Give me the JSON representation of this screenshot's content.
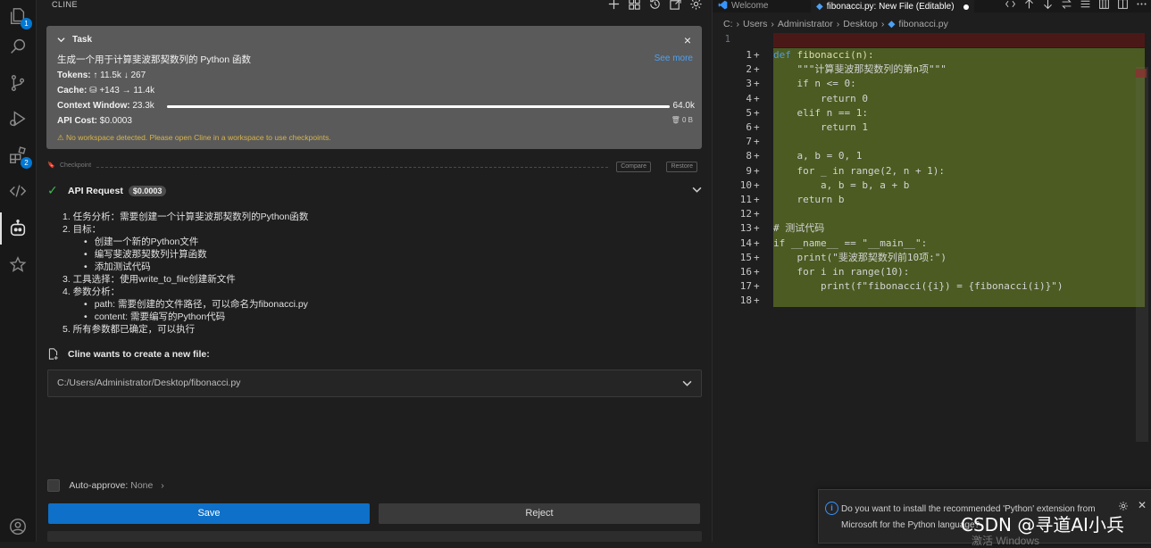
{
  "cline": {
    "header_title": "CLINE",
    "task": {
      "heading": "Task",
      "text": "生成一个用于计算斐波那契数列的 Python 函数",
      "see_more": "See more",
      "tokens_label": "Tokens:",
      "tokens_up": "11.5k",
      "tokens_down": "267",
      "cache_label": "Cache:",
      "cache_write": "+143",
      "cache_read": "11.4k",
      "context_label": "Context Window:",
      "context_used": "23.3k",
      "context_max": "64.0k",
      "cost_label": "API Cost:",
      "cost_value": "$0.0003",
      "storage_size": "0 B",
      "warning": "No workspace detected. Please open Cline in a workspace to use checkpoints."
    },
    "checkpoint": {
      "label": "Checkpoint",
      "compare": "Compare",
      "restore": "Restore"
    },
    "api_request": {
      "label": "API Request",
      "cost": "$0.0003"
    },
    "reasoning": [
      {
        "indent": 0,
        "text": "1. 任务分析：需要创建一个计算斐波那契数列的Python函数"
      },
      {
        "indent": 0,
        "text": "2. 目标："
      },
      {
        "indent": 1,
        "text": "创建一个新的Python文件"
      },
      {
        "indent": 1,
        "text": "编写斐波那契数列计算函数"
      },
      {
        "indent": 1,
        "text": "添加测试代码"
      },
      {
        "indent": 0,
        "text": "3. 工具选择：使用write_to_file创建新文件"
      },
      {
        "indent": 0,
        "text": "4. 参数分析："
      },
      {
        "indent": 1,
        "text": "path: 需要创建的文件路径，可以命名为fibonacci.py"
      },
      {
        "indent": 1,
        "text": "content: 需要编写的Python代码"
      },
      {
        "indent": 0,
        "text": "5. 所有参数都已确定，可以执行"
      }
    ],
    "new_file_title": "Cline wants to create a new file:",
    "file_path": "C:/Users/Administrator/Desktop/fibonacci.py",
    "auto_approve_label": "Auto-approve:",
    "auto_approve_value": "None",
    "save_label": "Save",
    "reject_label": "Reject"
  },
  "activity_bar": {
    "explorer_badge": "1",
    "extensions_badge": "2"
  },
  "editor": {
    "tabs": {
      "welcome": "Welcome",
      "active": "fibonacci.py: New File (Editable)"
    },
    "breadcrumbs": [
      "C:",
      "Users",
      "Administrator",
      "Desktop",
      "fibonacci.py"
    ],
    "original_line_number": "1",
    "code": {
      "1": "def fibonacci(n):",
      "2": "    \"\"\"计算斐波那契数列的第n项\"\"\"",
      "3": "    if n <= 0:",
      "4": "        return 0",
      "5": "    elif n == 1:",
      "6": "        return 1",
      "7": "",
      "8": "    a, b = 0, 1",
      "9": "    for _ in range(2, n + 1):",
      "10": "        a, b = b, a + b",
      "11": "    return b",
      "12": "",
      "13": "# 测试代码",
      "14": "if __name__ == \"__main__\":",
      "15": "    print(\"斐波那契数列前10项:\")",
      "16": "    for i in range(10):",
      "17": "        print(f\"fibonacci({i}) = {fibonacci(i)}\")",
      "18": ""
    }
  },
  "notification": {
    "text": "Do you want to install the recommended 'Python' extension from Microsoft for the Python language?"
  },
  "watermark": {
    "text": "CSDN @寻道AI小兵",
    "faint": "激活 Windows"
  },
  "colors": {
    "accent": "#0e70c8",
    "task_card": "#5a5a5a",
    "diff_added": "#4b5b22",
    "diff_removed": "#4b1818",
    "warning": "#d8b44a",
    "link": "#4ea1f3"
  }
}
